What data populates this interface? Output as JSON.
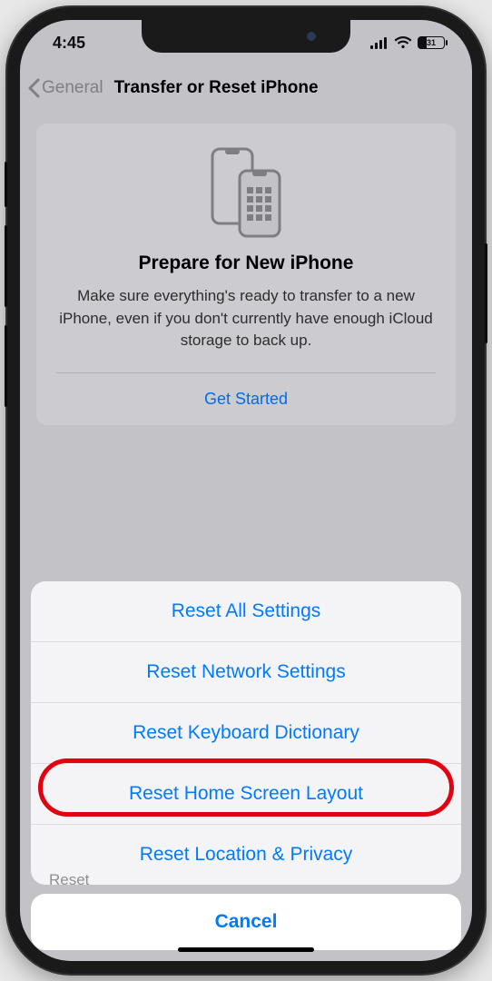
{
  "status": {
    "time": "4:45",
    "battery_pct": "31",
    "battery_fill_pct": 31
  },
  "nav": {
    "back_label": "General",
    "title": "Transfer or Reset iPhone"
  },
  "prepare_card": {
    "heading": "Prepare for New iPhone",
    "body": "Make sure everything's ready to transfer to a new iPhone, even if you don't currently have enough iCloud storage to back up.",
    "action": "Get Started"
  },
  "sheet": {
    "items": [
      "Reset All Settings",
      "Reset Network Settings",
      "Reset Keyboard Dictionary",
      "Reset Home Screen Layout",
      "Reset Location & Privacy"
    ],
    "cancel": "Cancel",
    "peek_below": "Reset"
  },
  "highlighted_index": 3,
  "colors": {
    "ios_blue": "#007aff",
    "highlight_red": "#e3000f"
  }
}
